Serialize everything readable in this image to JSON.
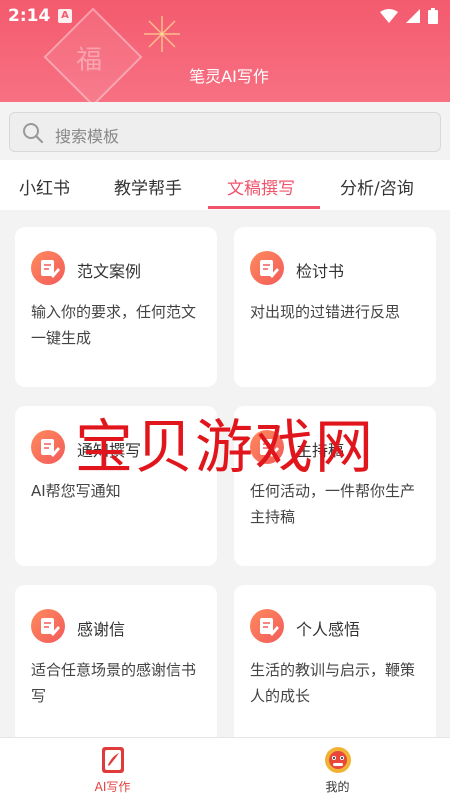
{
  "status_bar": {
    "time": "2:14",
    "badge": "A"
  },
  "header": {
    "app_title": "笔灵AI写作",
    "decor_char": "福"
  },
  "search": {
    "placeholder": "搜索模板"
  },
  "tabs": [
    {
      "label": "小红书",
      "active": false
    },
    {
      "label": "教学帮手",
      "active": false
    },
    {
      "label": "文稿撰写",
      "active": true
    },
    {
      "label": "分析/咨询",
      "active": false
    }
  ],
  "cards": [
    {
      "title": "范文案例",
      "desc": "输入你的要求，任何范文一键生成"
    },
    {
      "title": "检讨书",
      "desc": "对出现的过错进行反思"
    },
    {
      "title": "通知撰写",
      "desc": "AI帮您写通知"
    },
    {
      "title": "主持稿",
      "desc": "任何活动，一件帮你生产主持稿"
    },
    {
      "title": "感谢信",
      "desc": "适合任意场景的感谢信书写"
    },
    {
      "title": "个人感悟",
      "desc": "生活的教训与启示，鞭策人的成长"
    }
  ],
  "watermark": "宝贝游戏网",
  "bottom_nav": [
    {
      "label": "AI写作",
      "icon": "pen-book-icon",
      "active": true
    },
    {
      "label": "我的",
      "icon": "lion-mascot-icon",
      "active": false
    }
  ],
  "colors": {
    "accent": "#f0536a",
    "header_top": "#f45a6e",
    "icon_gradient_start": "#ff8a5c",
    "icon_gradient_end": "#f25b5b"
  }
}
